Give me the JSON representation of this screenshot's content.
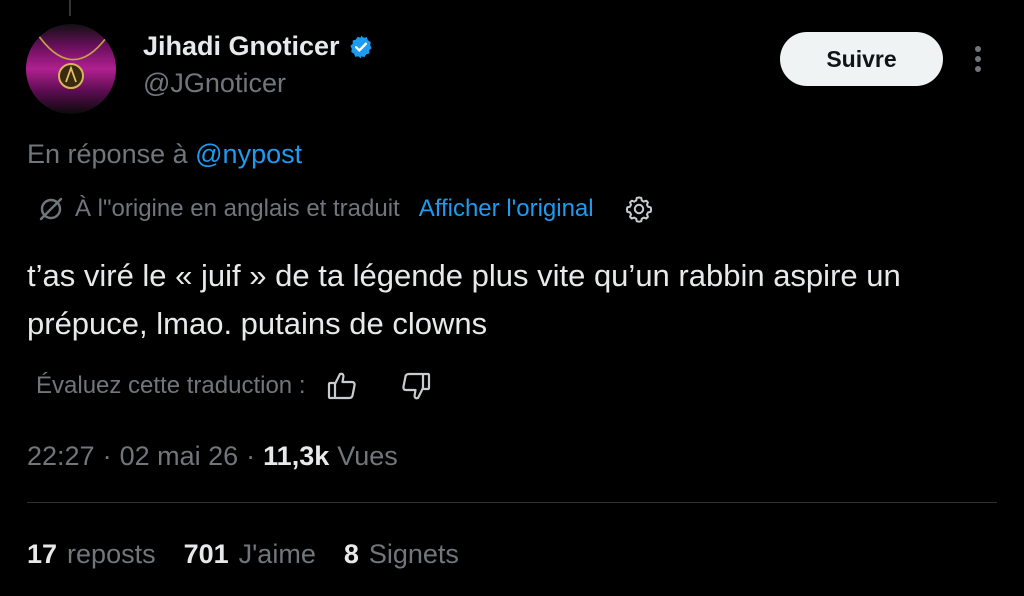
{
  "author": {
    "display_name": "Jihadi Gnoticer",
    "handle": "@JGnoticer",
    "verified": true,
    "avatar_icon": "pendant-necklace-avatar"
  },
  "follow_button": {
    "label": "Suivre"
  },
  "more_menu": {
    "icon": "vertical-ellipsis-icon"
  },
  "reply_context": {
    "prefix": "En réponse à",
    "mention": "@nypost"
  },
  "translation": {
    "icon": "translate-slash-icon",
    "origin_text": "À l\"origine en anglais et traduit",
    "show_original_label": "Afficher l'original",
    "settings_icon": "gear-icon"
  },
  "tweet": {
    "text": "t’as viré le « juif » de ta légende plus vite qu’un rabbin aspire un prépuce, lmao. putains de clowns"
  },
  "rate_translation": {
    "label": "Évaluez cette traduction :",
    "up_icon": "thumbs-up-icon",
    "down_icon": "thumbs-down-icon"
  },
  "meta": {
    "time": "22:27",
    "separator": "·",
    "date": "02 mai 26",
    "views_count": "11,3k",
    "views_label": "Vues"
  },
  "stats": [
    {
      "count": "17",
      "label": "reposts"
    },
    {
      "count": "701",
      "label": "J'aime"
    },
    {
      "count": "8",
      "label": "Signets"
    }
  ],
  "colors": {
    "background": "#000000",
    "text_primary": "#e7e9ea",
    "text_secondary": "#71767b",
    "link": "#1d9bf0",
    "verified": "#1d9bf0",
    "divider": "#2f3336"
  }
}
